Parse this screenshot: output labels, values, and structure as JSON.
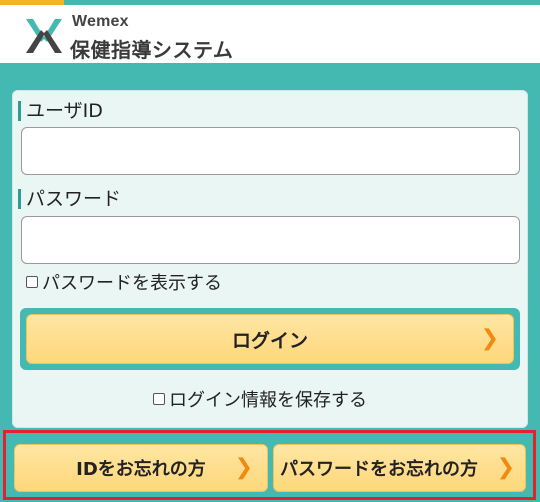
{
  "header": {
    "brand": "Wemex",
    "title": "保健指導システム"
  },
  "login_form": {
    "user_id_label": "ユーザID",
    "user_id_value": "",
    "password_label": "パスワード",
    "password_value": "",
    "show_password_label": "パスワードを表示する",
    "login_button": "ログイン",
    "save_login_label": "ログイン情報を保存する"
  },
  "links": {
    "forgot_id": "IDをお忘れの方",
    "forgot_password": "パスワードをお忘れの方"
  },
  "colors": {
    "teal": "#43b9b1",
    "accent_yellow": "#f5b421",
    "button_yellow": "#fdd77a",
    "chevron_orange": "#f08a10",
    "highlight_red": "#e0232e"
  },
  "icons": {
    "logo": "wemex-logo-icon",
    "chevron": "chevron-right-icon"
  }
}
